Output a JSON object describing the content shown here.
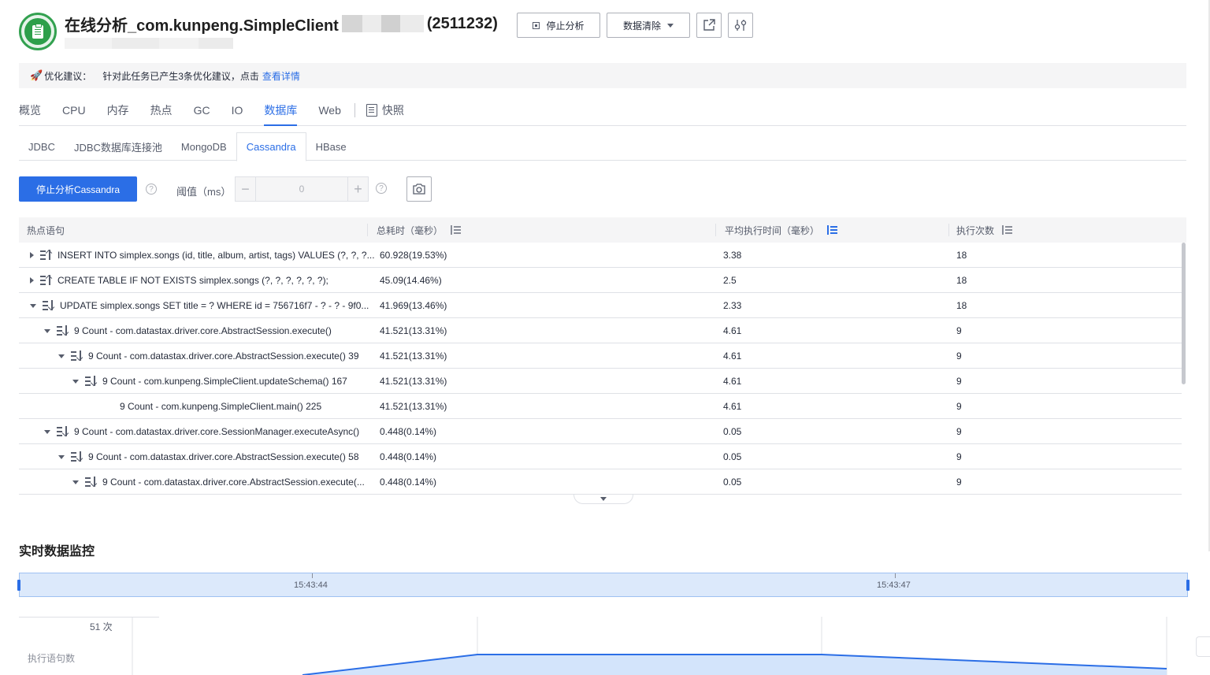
{
  "header": {
    "title": "在线分析_com.kunpeng.SimpleClient",
    "pid": "(2511232)",
    "stop_label": "停止分析",
    "clear_label": "数据清除",
    "export_icon": "export-icon",
    "settings_icon": "settings-icon"
  },
  "tip": {
    "prefix": "优化建议：",
    "text": "针对此任务已产生3条优化建议，点击",
    "link": "查看详情"
  },
  "main_tabs": [
    "概览",
    "CPU",
    "内存",
    "热点",
    "GC",
    "IO",
    "数据库",
    "Web",
    "快照"
  ],
  "active_main_tab": "数据库",
  "sub_tabs": [
    "JDBC",
    "JDBC数据库连接池",
    "MongoDB",
    "Cassandra",
    "HBase"
  ],
  "active_sub_tab": "Cassandra",
  "toolbar": {
    "stop_cassandra_label": "停止分析Cassandra",
    "threshold_label": "阈值（ms）",
    "threshold_value": "0"
  },
  "table": {
    "columns": [
      "热点语句",
      "总耗时（毫秒）",
      "平均执行时间（毫秒）",
      "执行次数"
    ],
    "rows": [
      {
        "statement": "INSERT INTO simplex.songs (id, title, album, artist, tags) VALUES (?, ?, ?...",
        "total": "60.928(19.53%)",
        "avg": "3.38",
        "count": "18"
      },
      {
        "statement": "CREATE TABLE IF NOT EXISTS simplex.songs (?, ?, ?, ?, ?, ?);",
        "total": "45.09(14.46%)",
        "avg": "2.5",
        "count": "18"
      },
      {
        "statement": "UPDATE simplex.songs SET title = ? WHERE id = 756716f7 - ? - ? - 9f0...",
        "total": "41.969(13.46%)",
        "avg": "2.33",
        "count": "18"
      },
      {
        "statement": "9 Count - com.datastax.driver.core.AbstractSession.execute()",
        "total": "41.521(13.31%)",
        "avg": "4.61",
        "count": "9"
      },
      {
        "statement": "9 Count - com.datastax.driver.core.AbstractSession.execute() 39",
        "total": "41.521(13.31%)",
        "avg": "4.61",
        "count": "9"
      },
      {
        "statement": "9 Count - com.kunpeng.SimpleClient.updateSchema() 167",
        "total": "41.521(13.31%)",
        "avg": "4.61",
        "count": "9"
      },
      {
        "statement": "9 Count - com.kunpeng.SimpleClient.main() 225",
        "total": "41.521(13.31%)",
        "avg": "4.61",
        "count": "9"
      },
      {
        "statement": "9 Count - com.datastax.driver.core.SessionManager.executeAsync()",
        "total": "0.448(0.14%)",
        "avg": "0.05",
        "count": "9"
      },
      {
        "statement": "9 Count - com.datastax.driver.core.AbstractSession.execute() 58",
        "total": "0.448(0.14%)",
        "avg": "0.05",
        "count": "9"
      },
      {
        "statement": "9 Count - com.datastax.driver.core.AbstractSession.execute(...",
        "total": "0.448(0.14%)",
        "avg": "0.05",
        "count": "9"
      }
    ]
  },
  "monitor": {
    "title": "实时数据监控",
    "timeline_labels": [
      "15:43:44",
      "15:43:47"
    ],
    "y_max_label": "51 次",
    "y_axis_name": "执行语句数"
  },
  "colors": {
    "accent": "#2b6ee6",
    "app_icon": "#2d9f4a",
    "rocket": "#e0453a"
  }
}
